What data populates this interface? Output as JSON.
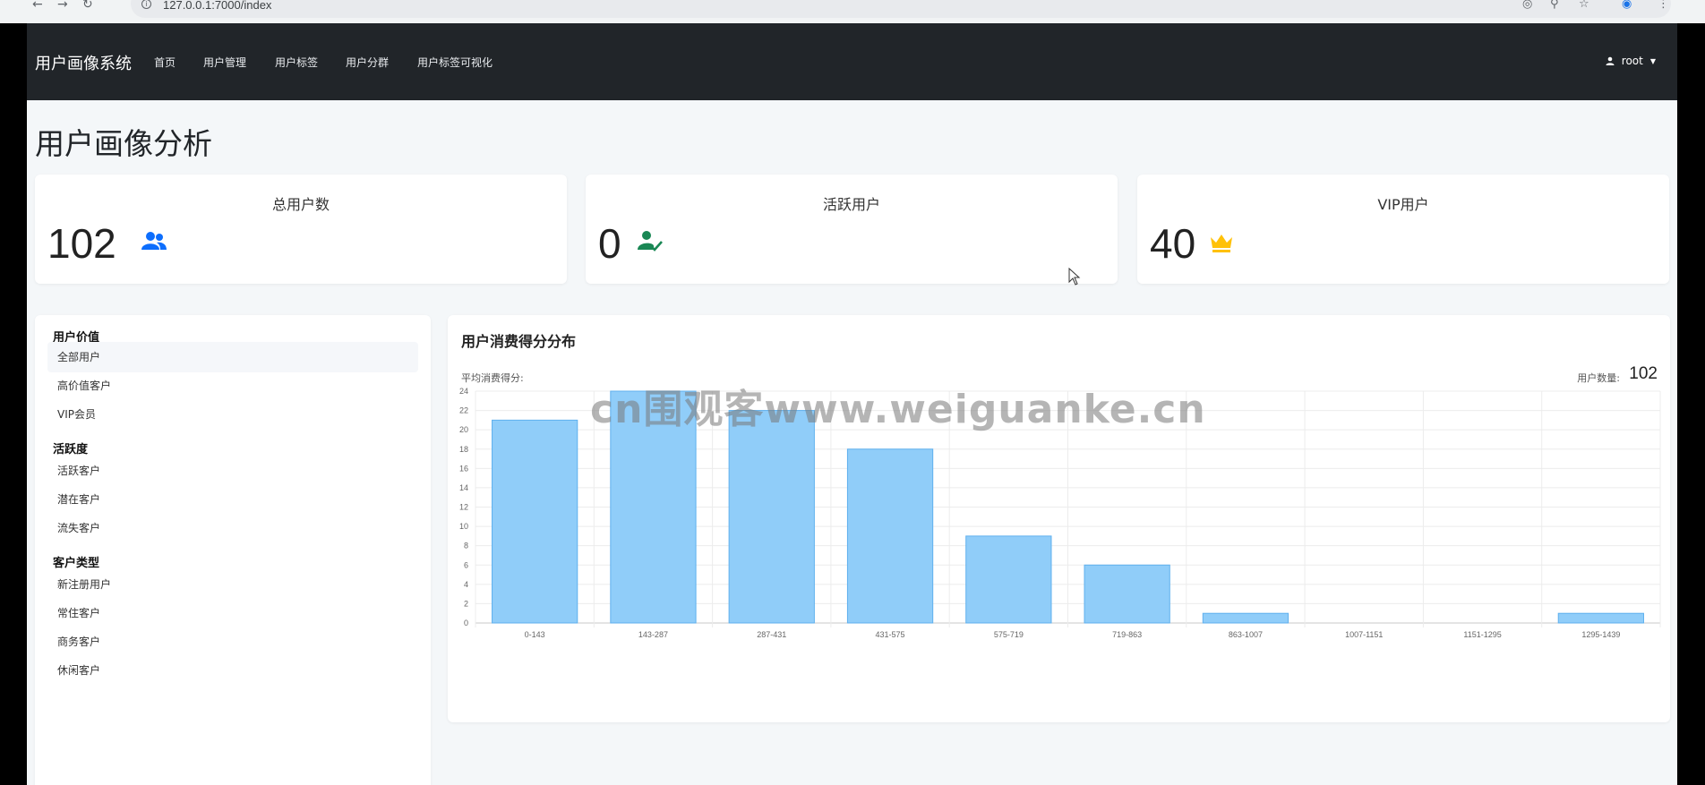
{
  "browser": {
    "url": "127.0.0.1:7000/index"
  },
  "navbar": {
    "brand": "用户画像系统",
    "links": [
      "首页",
      "用户管理",
      "用户标签",
      "用户分群",
      "用户标签可视化"
    ],
    "user": "root"
  },
  "page_title": "用户画像分析",
  "stats": [
    {
      "title": "总用户数",
      "value": "102",
      "icon": "users-icon",
      "color": "#0d6efd"
    },
    {
      "title": "活跃用户",
      "value": "0",
      "icon": "user-check-icon",
      "color": "#198754"
    },
    {
      "title": "VIP用户",
      "value": "40",
      "icon": "crown-icon",
      "color": "#ffc107"
    }
  ],
  "sidebar": {
    "groups": [
      {
        "heading": "用户价值",
        "items": [
          "全部用户",
          "高价值客户",
          "VIP会员"
        ]
      },
      {
        "heading": "活跃度",
        "items": [
          "活跃客户",
          "潜在客户",
          "流失客户"
        ]
      },
      {
        "heading": "客户类型",
        "items": [
          "新注册用户",
          "常住客户",
          "商务客户",
          "休闲客户"
        ]
      }
    ],
    "active_item": "全部用户"
  },
  "chart_card": {
    "title": "用户消费得分分布",
    "avg_label": "平均消费得分:",
    "count_label": "用户数量:",
    "count_value": "102"
  },
  "chart_data": {
    "type": "bar",
    "categories": [
      "0-143",
      "143-287",
      "287-431",
      "431-575",
      "575-719",
      "719-863",
      "863-1007",
      "1007-1151",
      "1151-1295",
      "1295-1439"
    ],
    "values": [
      21,
      24,
      22,
      18,
      9,
      6,
      1,
      0,
      0,
      1
    ],
    "ylim": [
      0,
      24
    ],
    "yticks": [
      0,
      2,
      4,
      6,
      8,
      10,
      12,
      14,
      16,
      18,
      20,
      22,
      24
    ],
    "grid": true,
    "bar_color": "#90cdf9",
    "bar_border": "#5fb0ee"
  },
  "watermark": "cn围观客www.weiguanke.cn"
}
